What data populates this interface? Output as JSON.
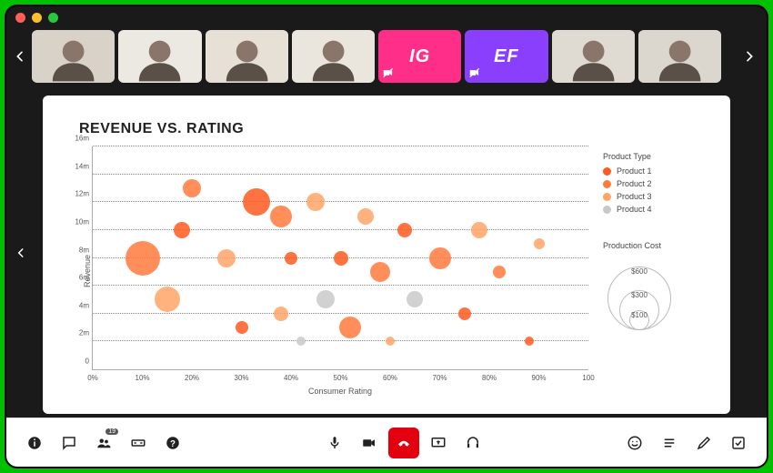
{
  "participants": [
    {
      "type": "video",
      "bg": "#d8d2c8"
    },
    {
      "type": "video",
      "bg": "#ece8e2"
    },
    {
      "type": "video",
      "bg": "#e6e0d6"
    },
    {
      "type": "video",
      "bg": "#eae5dd"
    },
    {
      "type": "initials",
      "label": "IG",
      "bg": "#ff2e88",
      "muted": true
    },
    {
      "type": "initials",
      "label": "EF",
      "bg": "#8a3ffc",
      "muted": true
    },
    {
      "type": "video",
      "bg": "#e0dbd2"
    },
    {
      "type": "video",
      "bg": "#dcd7ce"
    }
  ],
  "toolbar": {
    "participants_badge": "19"
  },
  "chart_data": {
    "type": "bubble",
    "title": "REVENUE VS. RATING",
    "xlabel": "Consumer Rating",
    "ylabel": "Revenue",
    "xlim": [
      0,
      100
    ],
    "ylim": [
      0,
      16
    ],
    "xticks": [
      "0%",
      "10%",
      "20%",
      "30%",
      "40%",
      "50%",
      "60%",
      "70%",
      "80%",
      "90%",
      "100"
    ],
    "yticks": [
      "0",
      "2m",
      "4m",
      "6m",
      "8m",
      "10m",
      "12m",
      "14m",
      "16m"
    ],
    "legend_title": "Product Type",
    "series_names": [
      "Product 1",
      "Product 2",
      "Product 3",
      "Product 4"
    ],
    "series_colors": [
      "#ff5a1f",
      "#ff7a3d",
      "#ffa566",
      "#c9c9c9"
    ],
    "size_legend": {
      "title": "Production Cost",
      "levels": [
        "$600",
        "$300",
        "$100"
      ]
    },
    "points": [
      {
        "x": 10,
        "y": 8,
        "r": 38,
        "series": 1
      },
      {
        "x": 15,
        "y": 5,
        "r": 28,
        "series": 2
      },
      {
        "x": 18,
        "y": 10,
        "r": 18,
        "series": 0
      },
      {
        "x": 20,
        "y": 13,
        "r": 20,
        "series": 1
      },
      {
        "x": 27,
        "y": 8,
        "r": 20,
        "series": 2
      },
      {
        "x": 30,
        "y": 3,
        "r": 14,
        "series": 0
      },
      {
        "x": 33,
        "y": 12,
        "r": 30,
        "series": 0
      },
      {
        "x": 38,
        "y": 11,
        "r": 24,
        "series": 1
      },
      {
        "x": 38,
        "y": 4,
        "r": 16,
        "series": 2
      },
      {
        "x": 40,
        "y": 8,
        "r": 14,
        "series": 0
      },
      {
        "x": 42,
        "y": 2,
        "r": 10,
        "series": 3
      },
      {
        "x": 45,
        "y": 12,
        "r": 20,
        "series": 2
      },
      {
        "x": 47,
        "y": 5,
        "r": 20,
        "series": 3
      },
      {
        "x": 50,
        "y": 8,
        "r": 16,
        "series": 0
      },
      {
        "x": 52,
        "y": 3,
        "r": 24,
        "series": 1
      },
      {
        "x": 55,
        "y": 11,
        "r": 18,
        "series": 2
      },
      {
        "x": 58,
        "y": 7,
        "r": 22,
        "series": 1
      },
      {
        "x": 60,
        "y": 2,
        "r": 10,
        "series": 2
      },
      {
        "x": 63,
        "y": 10,
        "r": 16,
        "series": 0
      },
      {
        "x": 65,
        "y": 5,
        "r": 18,
        "series": 3
      },
      {
        "x": 70,
        "y": 8,
        "r": 24,
        "series": 1
      },
      {
        "x": 75,
        "y": 4,
        "r": 14,
        "series": 0
      },
      {
        "x": 78,
        "y": 10,
        "r": 18,
        "series": 2
      },
      {
        "x": 82,
        "y": 7,
        "r": 14,
        "series": 1
      },
      {
        "x": 88,
        "y": 2,
        "r": 10,
        "series": 0
      },
      {
        "x": 90,
        "y": 9,
        "r": 12,
        "series": 2
      }
    ]
  }
}
